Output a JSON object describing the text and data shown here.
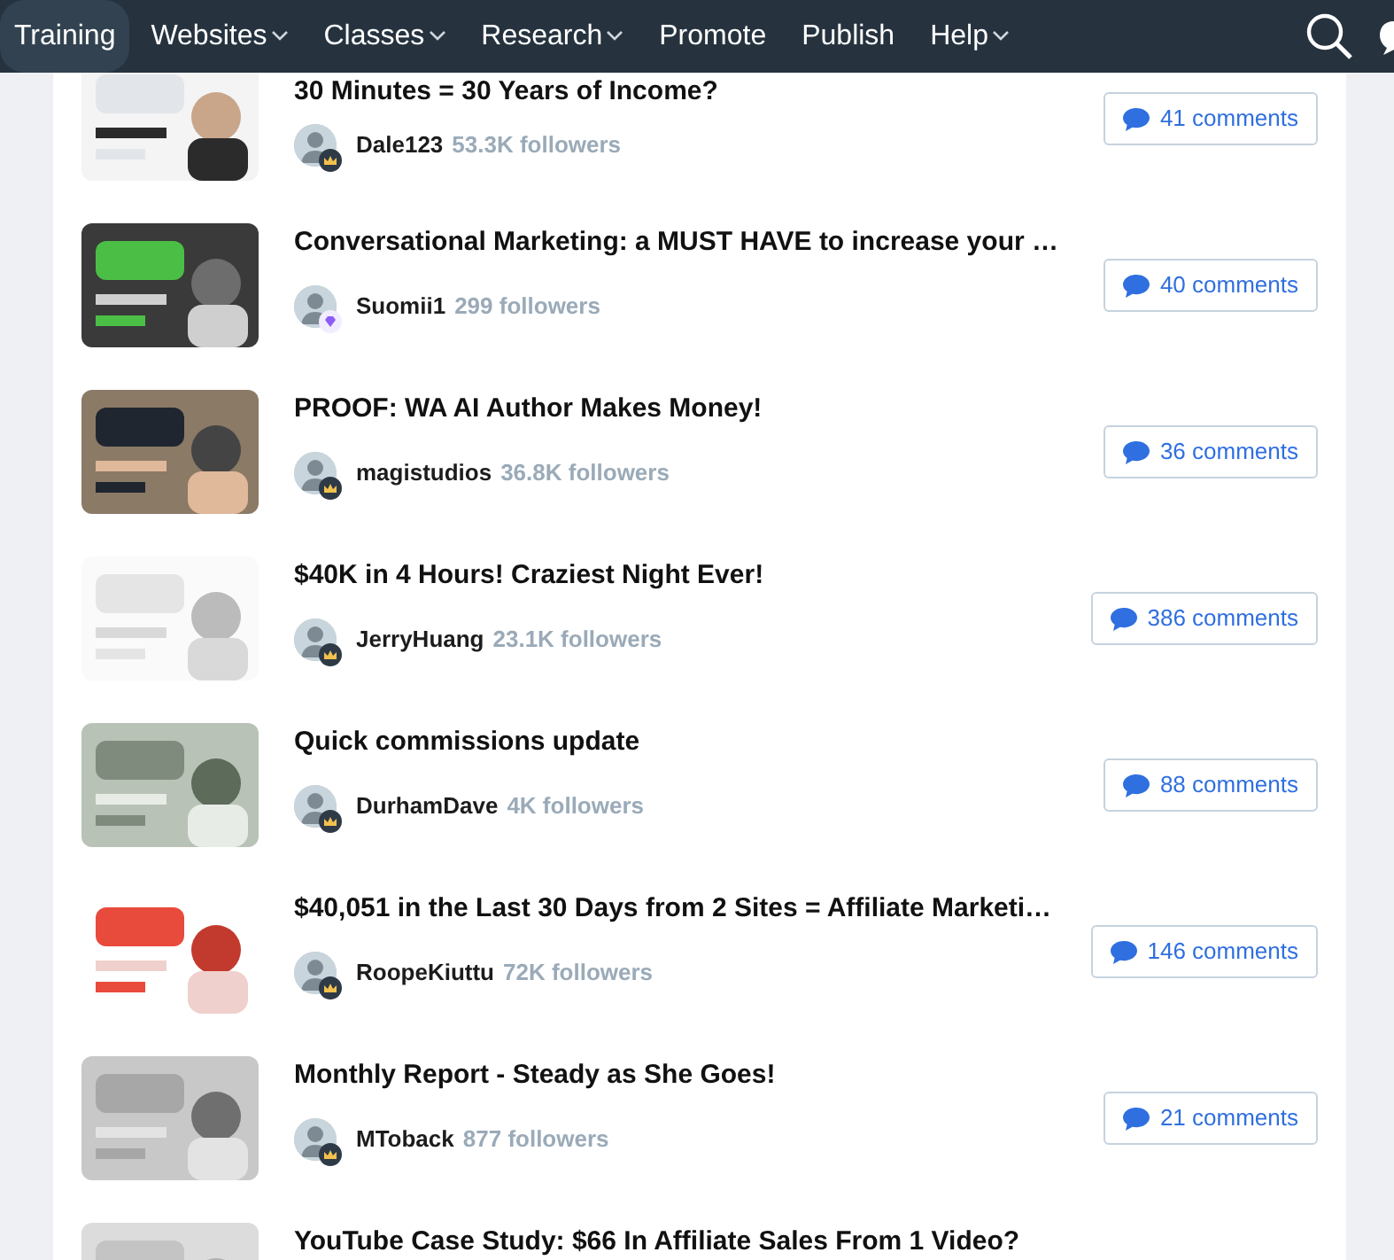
{
  "nav": {
    "items": [
      {
        "label": "Training",
        "selected": true,
        "dropdown": false
      },
      {
        "label": "Websites",
        "selected": false,
        "dropdown": true
      },
      {
        "label": "Classes",
        "selected": false,
        "dropdown": true
      },
      {
        "label": "Research",
        "selected": false,
        "dropdown": true
      },
      {
        "label": "Promote",
        "selected": false,
        "dropdown": false
      },
      {
        "label": "Publish",
        "selected": false,
        "dropdown": false
      },
      {
        "label": "Help",
        "selected": false,
        "dropdown": true
      }
    ]
  },
  "posts": [
    {
      "title": "30 Minutes = 30 Years of Income?",
      "author": "Dale123",
      "followers": "53.3K followers",
      "badge": {
        "kind": "crown"
      },
      "comments": "41 comments"
    },
    {
      "title": "Conversational Marketing: a MUST HAVE to increase your …",
      "author": "Suomii1",
      "followers": "299 followers",
      "badge": {
        "kind": "diamond"
      },
      "comments": "40 comments"
    },
    {
      "title": "PROOF: WA AI Author Makes Money!",
      "author": "magistudios",
      "followers": "36.8K followers",
      "badge": {
        "kind": "crown"
      },
      "comments": "36 comments"
    },
    {
      "title": "$40K in 4 Hours! Craziest Night Ever!",
      "author": "JerryHuang",
      "followers": "23.1K followers",
      "badge": {
        "kind": "crown"
      },
      "comments": "386 comments"
    },
    {
      "title": "Quick commissions update",
      "author": "DurhamDave",
      "followers": "4K followers",
      "badge": {
        "kind": "crown"
      },
      "comments": "88 comments"
    },
    {
      "title": "$40,051 in the Last 30 Days from 2 Sites = Affiliate Marketi…",
      "author": "RoopeKiuttu",
      "followers": "72K followers",
      "badge": {
        "kind": "crown"
      },
      "comments": "146 comments"
    },
    {
      "title": "Monthly Report - Steady as She Goes!",
      "author": "MToback",
      "followers": "877 followers",
      "badge": {
        "kind": "crown"
      },
      "comments": "21 comments"
    },
    {
      "title": "YouTube Case Study: $66 In Affiliate Sales From 1 Video?"
    }
  ]
}
